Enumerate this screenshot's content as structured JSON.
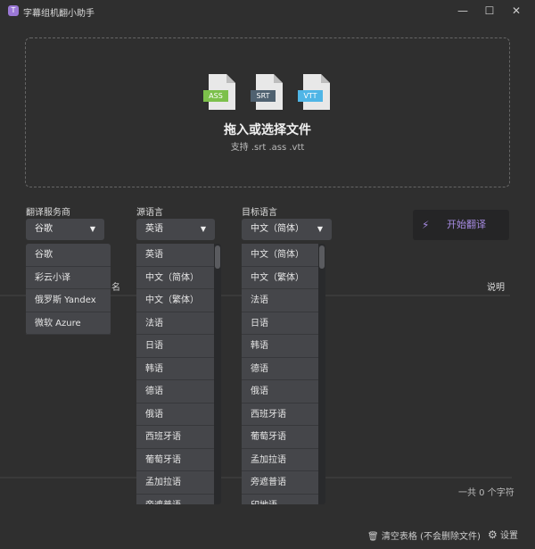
{
  "window": {
    "title": "字幕组机翻小助手",
    "app_icon": "T",
    "controls": [
      "minimize",
      "maximize",
      "close"
    ]
  },
  "dropzone": {
    "title": "拖入或选择文件",
    "subtitle": "支持 .srt .ass .vtt",
    "files": [
      {
        "label": "ASS",
        "color": "#7cc04b"
      },
      {
        "label": "SRT",
        "color": "#4f6170"
      },
      {
        "label": "VTT",
        "color": "#4fb5e6"
      }
    ]
  },
  "provider": {
    "label": "翻译服务商",
    "value": "谷歌",
    "options": [
      "谷歌",
      "彩云小译",
      "俄罗斯 Yandex",
      "微软 Azure"
    ]
  },
  "source": {
    "label": "源语言",
    "value": "英语",
    "options": [
      "英语",
      "中文（简体）",
      "中文（繁体）",
      "法语",
      "日语",
      "韩语",
      "德语",
      "俄语",
      "西班牙语",
      "葡萄牙语",
      "孟加拉语",
      "旁遮普语"
    ]
  },
  "target": {
    "label": "目标语言",
    "value": "中文（简体）",
    "options": [
      "中文（简体）",
      "中文（繁体）",
      "法语",
      "日语",
      "韩语",
      "德语",
      "俄语",
      "西班牙语",
      "葡萄牙语",
      "孟加拉语",
      "旁遮普语",
      "印地语"
    ]
  },
  "start_button": {
    "label": "开始翻译",
    "icon": "lightning-icon"
  },
  "table": {
    "columns": [
      "名",
      "说明"
    ]
  },
  "footer": {
    "count": "一共 0 个字符",
    "clear_label": "清空表格 (不会删除文件)",
    "settings_label": "设置"
  },
  "colors": {
    "accent": "#a58ae0",
    "background": "#2f2f2f"
  }
}
